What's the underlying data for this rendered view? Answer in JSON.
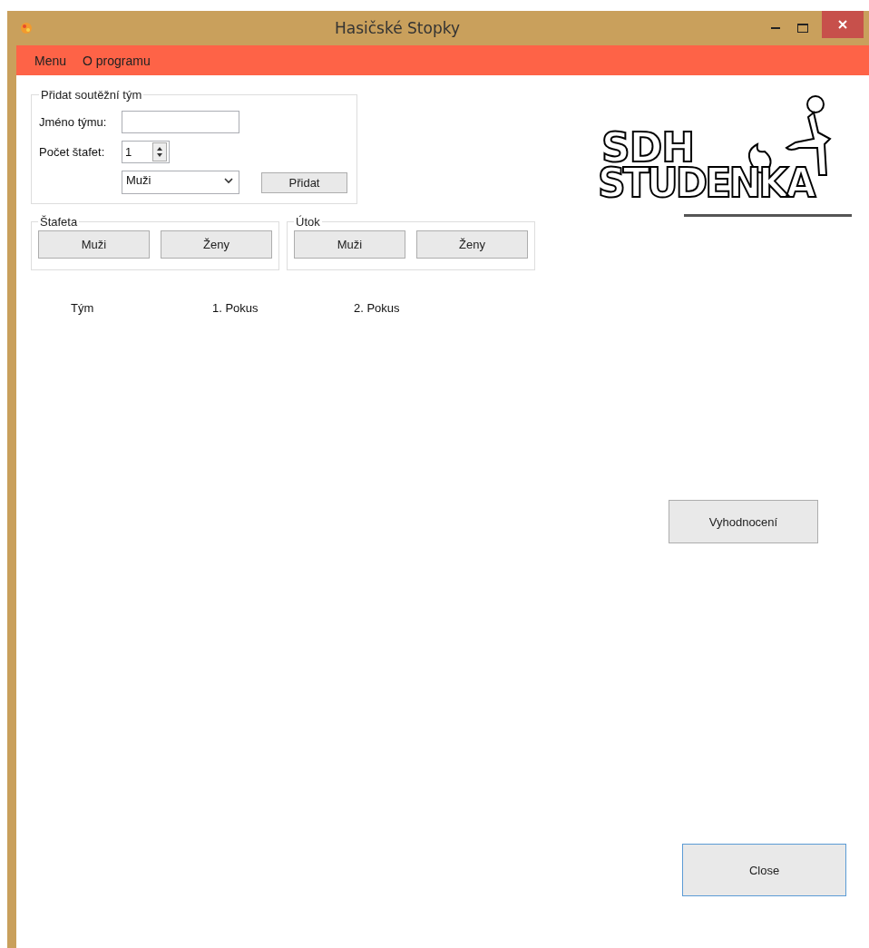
{
  "window": {
    "title": "Hasičské Stopky"
  },
  "menu": [
    "Menu",
    "O programu"
  ],
  "add_team": {
    "title": "Přidat soutěžní tým",
    "name_label": "Jméno týmu:",
    "count_label": "Počet štafet:",
    "count_value": "1",
    "category_value": "Muži",
    "add_button": "Přidat"
  },
  "groups": [
    {
      "title": "Štafeta",
      "buttons": [
        "Muži",
        "Ženy"
      ]
    },
    {
      "title": "Útok",
      "buttons": [
        "Muži",
        "Ženy"
      ]
    }
  ],
  "table": {
    "columns": [
      "Tým",
      "1. Pokus",
      "2. Pokus"
    ]
  },
  "logo": {
    "line_1": "SDH",
    "line_2": "STUDENKA"
  },
  "evaluate_button": "Vyhodnocení",
  "close_button": "Close"
}
